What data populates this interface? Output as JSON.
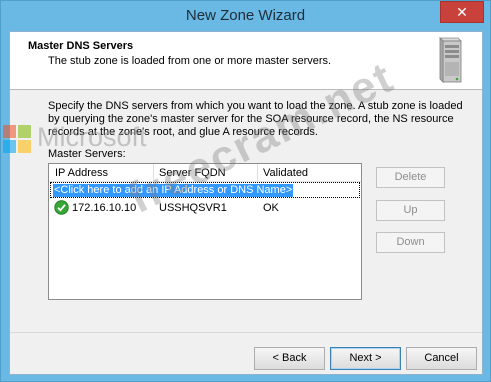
{
  "window": {
    "title": "New Zone Wizard",
    "close_glyph": "✕"
  },
  "header": {
    "title": "Master DNS Servers",
    "subtitle": "The stub zone is loaded from one or more master servers.",
    "icon": "server-icon"
  },
  "description": "Specify the DNS servers from which you want to load the zone. A stub zone is loaded by querying the zone's master server for the SOA resource record, the NS resource records at the zone's root, and glue A resource records.",
  "master_servers": {
    "label": "Master Servers:",
    "columns": [
      "IP Address",
      "Server FQDN",
      "Validated"
    ],
    "add_row_text": "<Click here to add an IP Address or DNS Name>",
    "rows": [
      {
        "ip": "172.16.10.10",
        "fqdn": "USSHQSVR1",
        "validated": "OK",
        "status_icon": "check-icon"
      }
    ]
  },
  "side_buttons": {
    "delete": "Delete",
    "up": "Up",
    "down": "Down"
  },
  "footer": {
    "back": "< Back",
    "next": "Next >",
    "cancel": "Cancel"
  },
  "watermarks": {
    "brand": "Microsoft",
    "site": "freecram.net"
  },
  "colors": {
    "title_bar": "#6ab8e4",
    "close_button": "#c8423b",
    "selection": "#3399ff",
    "check": "#2f9a2f"
  }
}
